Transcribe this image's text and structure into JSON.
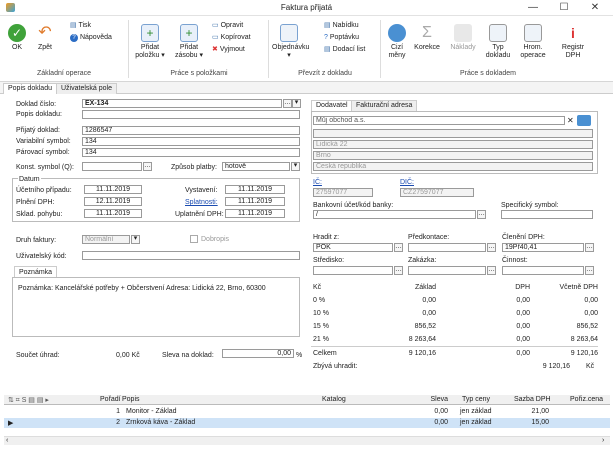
{
  "window": {
    "title": "Faktura přijatá",
    "min": "—",
    "max": "☐",
    "close": "✕"
  },
  "ribbon": {
    "ok": "OK",
    "back": "Zpět",
    "print": "Tisk",
    "help": "Nápověda",
    "add_item": "Přidat položku ▾",
    "add_stock": "Přidat zásobu ▾",
    "edit": "Opravit",
    "copy": "Kopírovat",
    "cut": "Vyjmout",
    "order": "Objednávku ▾",
    "offer": "Nabídku",
    "query": "Poptávku",
    "delivery": "Dodací list",
    "foreign": "Cizí měny",
    "correction": "Korekce",
    "costs": "Náklady",
    "doc_type": "Typ dokladu",
    "bulk": "Hrom. operace",
    "vat_reg": "Registr DPH",
    "groups": [
      "Základní operace",
      "Práce s položkami",
      "Převzít z dokladu",
      "Práce s dokladem"
    ]
  },
  "tabs": [
    "Popis dokladu",
    "Uživatelská pole"
  ],
  "form": {
    "doc_no_label": "Doklad číslo:",
    "doc_no": "EX-134",
    "desc_label": "Popis dokladu:",
    "desc": "",
    "received_label": "Přijatý doklad:",
    "received": "1286547",
    "vs_label": "Variabilní symbol:",
    "vs": "134",
    "ps_label": "Párovací symbol:",
    "ps": "134",
    "ks_label": "Konst. symbol (Q):",
    "ks": "",
    "payment_label": "Způsob platby:",
    "payment": "hotově",
    "dates_title": "Datum",
    "acc_date_label": "Účetního případu:",
    "acc_date": "11.11.2019",
    "issued_label": "Vystavení:",
    "issued": "11.11.2019",
    "vat_date_label": "Plnění DPH:",
    "vat_date": "12.11.2019",
    "due_label": "Splatnosti:",
    "due": "11.11.2019",
    "stock_date_label": "Sklad. pohybu:",
    "stock_date": "11.11.2019",
    "claim_label": "Uplatnění DPH:",
    "claim": "11.11.2019",
    "kind_label": "Druh faktury:",
    "kind": "Normální",
    "credit_note": "Dobropis",
    "user_code_label": "Uživatelský kód:",
    "user_code": "",
    "note_title": "Poznámka",
    "note": "Poznámka: Kancelářské potřeby + Občerstvení Adresa: Lidická 22, Brno, 60300",
    "sum_label": "Součet úhrad:",
    "sum": "0,00 Kč",
    "discount_label": "Sleva na doklad:",
    "discount": "0,00",
    "discount_unit": "%"
  },
  "supplier": {
    "tabs": [
      "Dodavatel",
      "Fakturační adresa"
    ],
    "name": "Můj obchod a.s.",
    "street": "Lidická 22",
    "city": "Brno",
    "country": "Česká republika",
    "ico_label": "IČ:",
    "ico": "27597077",
    "dic_label": "DIČ:",
    "dic": "CZ27597077",
    "bank_label": "Bankovní účet/kód banky:",
    "bank": "/",
    "spec_label": "Specifický symbol:",
    "spec": "",
    "pay_label": "Hradit z:",
    "pay": "POK",
    "precont_label": "Předkontace:",
    "precont": "",
    "vatsplit_label": "Členění DPH:",
    "vatsplit": "19Př40,41",
    "centre_label": "Středisko:",
    "centre": "",
    "contract_label": "Zakázka:",
    "contract": "",
    "activity_label": "Činnost:",
    "activity": ""
  },
  "vat": {
    "headers": [
      "Kč",
      "Základ",
      "DPH",
      "Včetně DPH"
    ],
    "rows": [
      [
        "0 %",
        "0,00",
        "0,00",
        "0,00"
      ],
      [
        "10 %",
        "0,00",
        "0,00",
        "0,00"
      ],
      [
        "15 %",
        "856,52",
        "0,00",
        "856,52"
      ],
      [
        "21 %",
        "8 263,64",
        "0,00",
        "8 263,64"
      ]
    ],
    "total": [
      "Celkem",
      "9 120,16",
      "0,00",
      "9 120,16"
    ],
    "topay_label": "Zbývá uhradit:",
    "topay": "9 120,16",
    "topay_cur": "Kč"
  },
  "items": {
    "headers": [
      "Pořadí",
      "Popis",
      "Katalog",
      "Sleva",
      "Typ ceny",
      "Sazba DPH",
      "Pořiz.cena"
    ],
    "rows": [
      {
        "order": "1",
        "desc": "Monitor - Základ",
        "catalog": "",
        "discount": "0,00",
        "ptype": "jen základ",
        "vat": "21,00",
        "price": ""
      },
      {
        "order": "2",
        "desc": "Zrnková káva - Základ",
        "catalog": "",
        "discount": "0,00",
        "ptype": "jen základ",
        "vat": "15,00",
        "price": ""
      }
    ]
  }
}
